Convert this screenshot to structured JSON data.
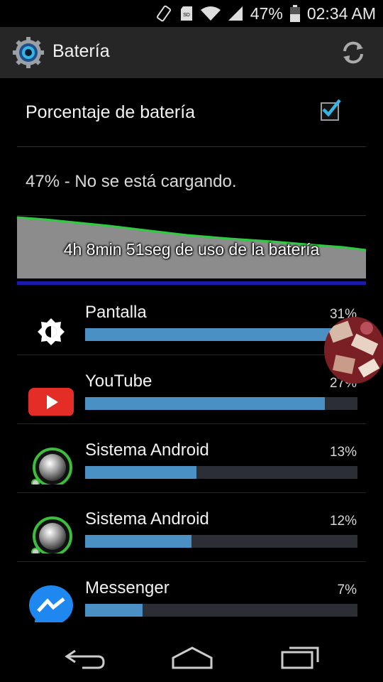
{
  "status_bar": {
    "battery_percent": "47%",
    "time": "02:34 AM",
    "icons": [
      "rotation-lock-icon",
      "sd-card-icon",
      "wifi-icon",
      "signal-icon",
      "battery-icon"
    ]
  },
  "action_bar": {
    "title": "Batería",
    "icons": [
      "settings-gear-icon",
      "refresh-icon"
    ]
  },
  "settings": {
    "percentage_label": "Porcentaje de batería",
    "percentage_checked": true
  },
  "battery_status": "47% - No se está cargando.",
  "usage_graph": {
    "caption": "4h 8min 51seg de uso de la batería",
    "colors": {
      "fill": "#8c8c8c",
      "line": "#2ecc40",
      "charging_bar": "#1a1aa8"
    }
  },
  "apps": [
    {
      "name": "Pantalla",
      "percent_label": "31%",
      "fraction": 1.0,
      "icon": "brightness-icon"
    },
    {
      "name": "YouTube",
      "percent_label": "27%",
      "fraction": 0.88,
      "icon": "youtube-icon"
    },
    {
      "name": "Sistema Android",
      "percent_label": "13%",
      "fraction": 0.41,
      "icon": "android-system-icon"
    },
    {
      "name": "Sistema Android",
      "percent_label": "12%",
      "fraction": 0.39,
      "icon": "android-system-icon"
    },
    {
      "name": "Messenger",
      "percent_label": "7%",
      "fraction": 0.21,
      "icon": "messenger-icon"
    }
  ],
  "colors": {
    "accent": "#33b5e5",
    "bar_fill": "#4a90c5",
    "bar_track": "#2b2e35",
    "action_bar_bg": "#262626"
  },
  "nav_bar": {
    "buttons": [
      "back-icon",
      "home-icon",
      "recents-icon"
    ]
  }
}
